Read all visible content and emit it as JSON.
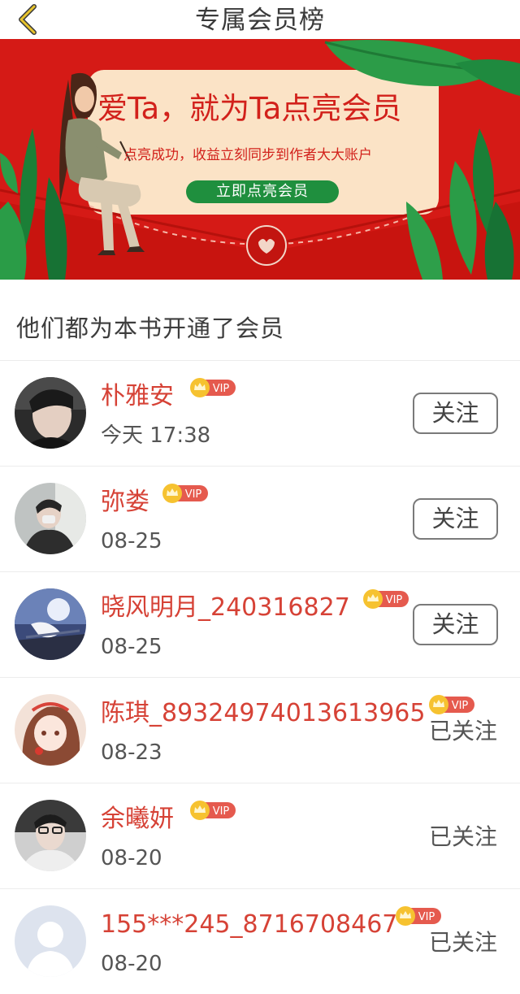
{
  "header": {
    "title": "专属会员榜",
    "back_icon": "chevron-left-icon",
    "accent": "#e8c42c"
  },
  "banner": {
    "headline": "爱Ta，就为Ta点亮会员",
    "subline": "点亮成功，收益立刻同步到作者大大账户",
    "button_label": "立即点亮会员",
    "colors": {
      "background": "#d51a16",
      "card": "#fbe3c6",
      "button": "#1f8f3e",
      "text": "#d2211b"
    }
  },
  "section": {
    "title": "他们都为本书开通了会员"
  },
  "members": [
    {
      "name": "朴雅安",
      "vip_label": "VIP",
      "date": "今天 17:38",
      "follow_label": "关注",
      "followed": false
    },
    {
      "name": "弥娄",
      "vip_label": "VIP",
      "date": "08-25",
      "follow_label": "关注",
      "followed": false
    },
    {
      "name": "晓风明月_240316827",
      "vip_label": "VIP",
      "date": "08-25",
      "follow_label": "关注",
      "followed": false
    },
    {
      "name": "陈琪_89324974013613965",
      "vip_label": "VIP",
      "date": "08-23",
      "follow_label": "已关注",
      "followed": true
    },
    {
      "name": "余曦妍",
      "vip_label": "VIP",
      "date": "08-20",
      "follow_label": "已关注",
      "followed": true
    },
    {
      "name": "155***245_8716708467",
      "vip_label": "VIP",
      "date": "08-20",
      "follow_label": "已关注",
      "followed": true
    }
  ]
}
